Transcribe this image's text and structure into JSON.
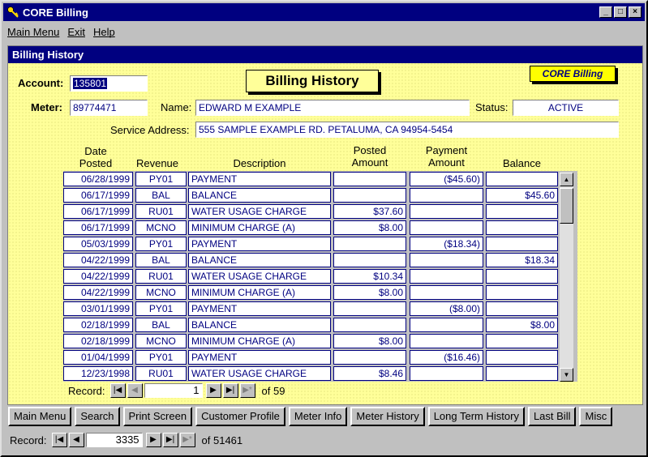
{
  "window": {
    "title": "CORE Billing",
    "min": "_",
    "max": "□",
    "close": "×"
  },
  "menu": {
    "main_menu": "Main Menu",
    "exit": "Exit",
    "help": "Help"
  },
  "form": {
    "header": "Billing History",
    "title": "Billing History",
    "badge": "CORE Billing",
    "account_label": "Account:",
    "account_value": "135801",
    "meter_label": "Meter:",
    "meter_value": "89774471",
    "name_label": "Name:",
    "name_value": "EDWARD M EXAMPLE",
    "status_label": "Status:",
    "status_value": "ACTIVE",
    "address_label": "Service Address:",
    "address_value": "555 SAMPLE EXAMPLE RD. PETALUMA, CA  94954-5454"
  },
  "columns": {
    "date": "Date\nPosted",
    "revenue": "Revenue",
    "description": "Description",
    "posted": "Posted\nAmount",
    "payment": "Payment\nAmount",
    "balance": "Balance"
  },
  "rows": [
    {
      "date": "06/28/1999",
      "rev": "PY01",
      "desc": "PAYMENT",
      "posted": "",
      "payment": "($45.60)",
      "balance": ""
    },
    {
      "date": "06/17/1999",
      "rev": "BAL",
      "desc": "BALANCE",
      "posted": "",
      "payment": "",
      "balance": "$45.60"
    },
    {
      "date": "06/17/1999",
      "rev": "RU01",
      "desc": "WATER USAGE CHARGE",
      "posted": "$37.60",
      "payment": "",
      "balance": ""
    },
    {
      "date": "06/17/1999",
      "rev": "MCNO",
      "desc": "MINIMUM CHARGE (A)",
      "posted": "$8.00",
      "payment": "",
      "balance": ""
    },
    {
      "date": "05/03/1999",
      "rev": "PY01",
      "desc": "PAYMENT",
      "posted": "",
      "payment": "($18.34)",
      "balance": ""
    },
    {
      "date": "04/22/1999",
      "rev": "BAL",
      "desc": "BALANCE",
      "posted": "",
      "payment": "",
      "balance": "$18.34"
    },
    {
      "date": "04/22/1999",
      "rev": "RU01",
      "desc": "WATER USAGE CHARGE",
      "posted": "$10.34",
      "payment": "",
      "balance": ""
    },
    {
      "date": "04/22/1999",
      "rev": "MCNO",
      "desc": "MINIMUM CHARGE (A)",
      "posted": "$8.00",
      "payment": "",
      "balance": ""
    },
    {
      "date": "03/01/1999",
      "rev": "PY01",
      "desc": "PAYMENT",
      "posted": "",
      "payment": "($8.00)",
      "balance": ""
    },
    {
      "date": "02/18/1999",
      "rev": "BAL",
      "desc": "BALANCE",
      "posted": "",
      "payment": "",
      "balance": "$8.00"
    },
    {
      "date": "02/18/1999",
      "rev": "MCNO",
      "desc": "MINIMUM CHARGE (A)",
      "posted": "$8.00",
      "payment": "",
      "balance": ""
    },
    {
      "date": "01/04/1999",
      "rev": "PY01",
      "desc": "PAYMENT",
      "posted": "",
      "payment": "($16.46)",
      "balance": ""
    },
    {
      "date": "12/23/1998",
      "rev": "RU01",
      "desc": "WATER USAGE CHARGE",
      "posted": "$8.46",
      "payment": "",
      "balance": ""
    }
  ],
  "subnav": {
    "label": "Record:",
    "current": "1",
    "of": "of 59"
  },
  "buttons": [
    "Main Menu",
    "Search",
    "Print Screen",
    "Customer Profile",
    "Meter Info",
    "Meter History",
    "Long Term History",
    "Last Bill",
    "Misc"
  ],
  "mainnav": {
    "label": "Record:",
    "current": "3335",
    "of": "of 51461"
  },
  "colors": {
    "titlebar": "#000080",
    "form_bg": "#ffff99",
    "badge": "#ffff00",
    "field_text": "#000080"
  }
}
